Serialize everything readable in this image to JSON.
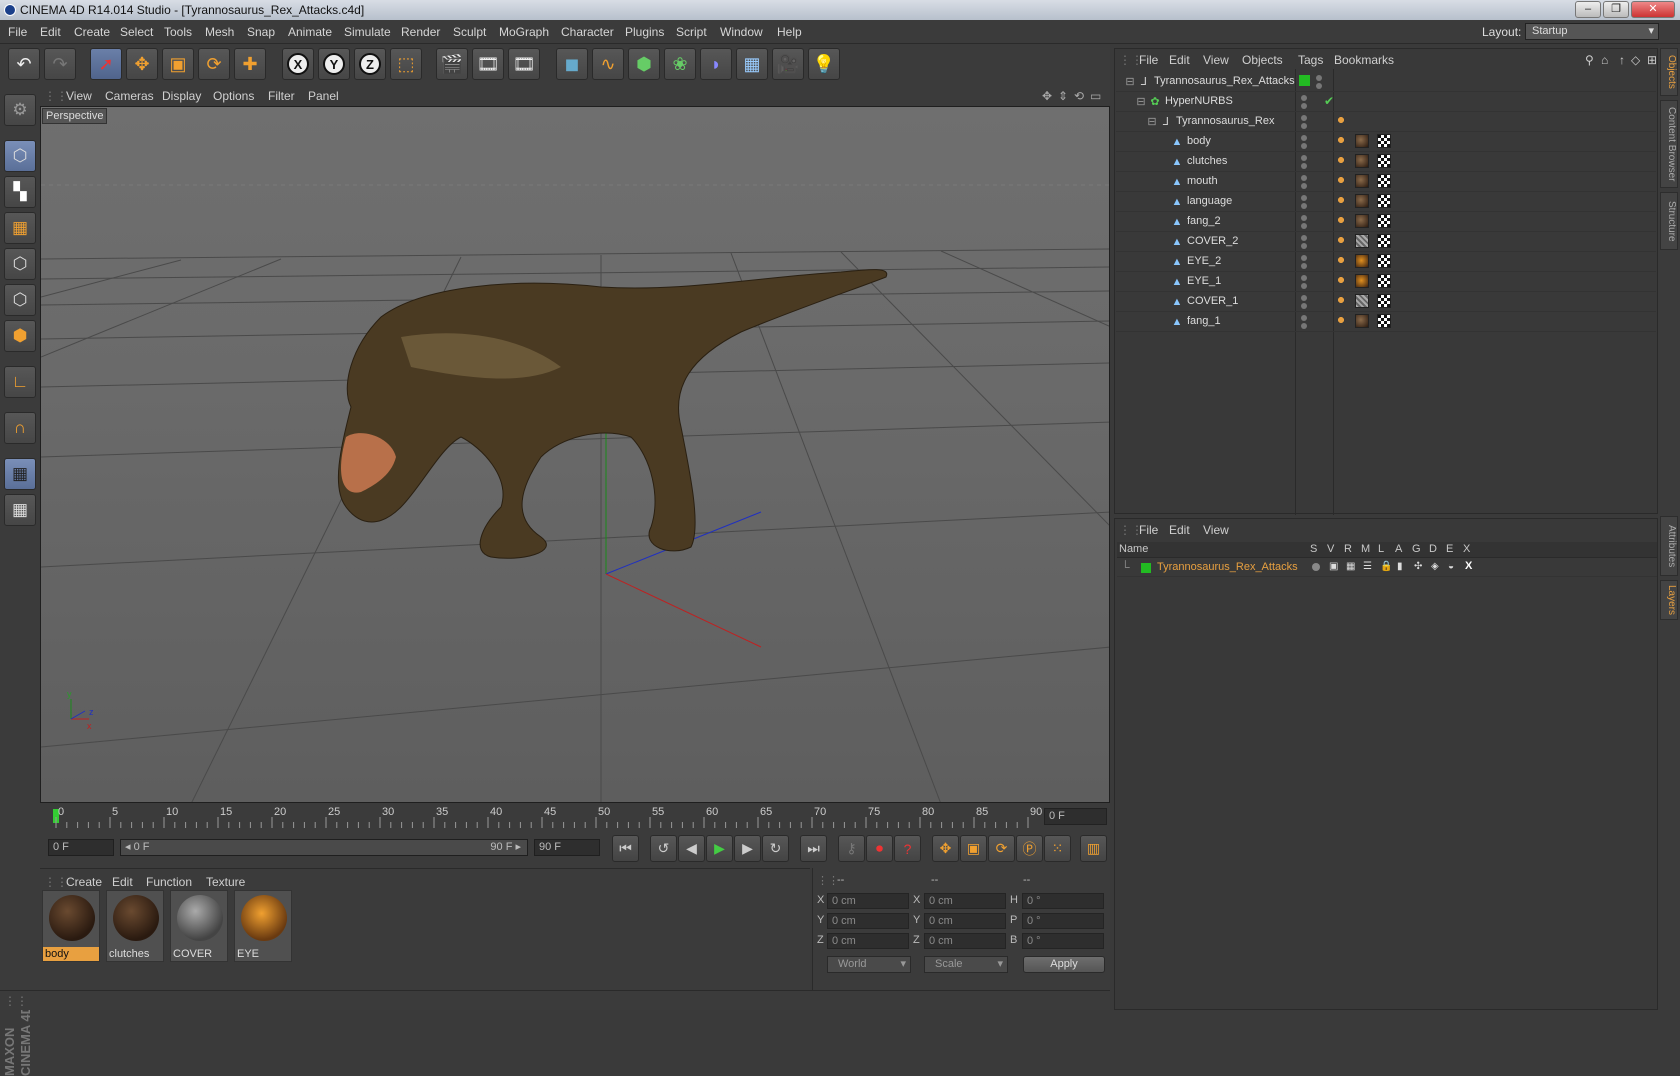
{
  "window": {
    "title": "CINEMA 4D R14.014 Studio - [Tyrannosaurus_Rex_Attacks.c4d]",
    "buttons": [
      "–",
      "❐",
      "✕"
    ]
  },
  "menubar": {
    "items": [
      "File",
      "Edit",
      "Create",
      "Select",
      "Tools",
      "Mesh",
      "Snap",
      "Animate",
      "Simulate",
      "Render",
      "Sculpt",
      "MoGraph",
      "Character",
      "Plugins",
      "Script",
      "Window",
      "Help"
    ],
    "layout_label": "Layout:",
    "layout_value": "Startup"
  },
  "toolbar": {
    "axis_x": "X",
    "axis_y": "Y",
    "axis_z": "Z"
  },
  "viewport": {
    "menu": [
      "View",
      "Cameras",
      "Display",
      "Options",
      "Filter",
      "Panel"
    ],
    "camera_label": "Perspective",
    "axis_labels": {
      "x": "x",
      "y": "y",
      "z": "z"
    }
  },
  "timeline": {
    "ticks": [
      "0",
      "5",
      "10",
      "15",
      "20",
      "25",
      "30",
      "35",
      "40",
      "45",
      "50",
      "55",
      "60",
      "65",
      "70",
      "75",
      "80",
      "85",
      "90"
    ],
    "current_frame": "0 F"
  },
  "transport": {
    "start": "0 F",
    "range_start": "◂ 0 F",
    "range_end": "90 F ▸",
    "end": "90 F"
  },
  "material_manager": {
    "menu": [
      "Create",
      "Edit",
      "Function",
      "Texture"
    ],
    "materials": [
      {
        "name": "body",
        "selected": true
      },
      {
        "name": "clutches",
        "selected": false
      },
      {
        "name": "COVER",
        "selected": false
      },
      {
        "name": "EYE",
        "selected": false
      }
    ]
  },
  "coordinates": {
    "headers": [
      "--",
      "--",
      "--"
    ],
    "rows": [
      {
        "a": "X",
        "av": "0 cm",
        "b": "X",
        "bv": "0 cm",
        "c": "H",
        "cv": "0 °"
      },
      {
        "a": "Y",
        "av": "0 cm",
        "b": "Y",
        "bv": "0 cm",
        "c": "P",
        "cv": "0 °"
      },
      {
        "a": "Z",
        "av": "0 cm",
        "b": "Z",
        "bv": "0 cm",
        "c": "B",
        "cv": "0 °"
      }
    ],
    "mode": "World",
    "transform": "Scale",
    "apply": "Apply"
  },
  "object_manager": {
    "menu": [
      "File",
      "Edit",
      "View",
      "Objects",
      "Tags",
      "Bookmarks"
    ],
    "objects": [
      {
        "name": "Tyrannosaurus_Rex_Attacks",
        "indent": 0,
        "tags": []
      },
      {
        "name": "HyperNURBS",
        "indent": 1,
        "tags": []
      },
      {
        "name": "Tyrannosaurus_Rex",
        "indent": 2,
        "tags": [
          "phong"
        ]
      },
      {
        "name": "body",
        "indent": 3,
        "tags": [
          "phong",
          "tex",
          "chk"
        ]
      },
      {
        "name": "clutches",
        "indent": 3,
        "tags": [
          "phong",
          "tex",
          "chk"
        ]
      },
      {
        "name": "mouth",
        "indent": 3,
        "tags": [
          "phong",
          "tex",
          "chk"
        ]
      },
      {
        "name": "language",
        "indent": 3,
        "tags": [
          "phong",
          "tex",
          "chk"
        ]
      },
      {
        "name": "fang_2",
        "indent": 3,
        "tags": [
          "phong",
          "tex",
          "chk"
        ]
      },
      {
        "name": "COVER_2",
        "indent": 3,
        "tags": [
          "phong",
          "cov",
          "chk"
        ]
      },
      {
        "name": "EYE_2",
        "indent": 3,
        "tags": [
          "phong",
          "eye",
          "chk"
        ]
      },
      {
        "name": "EYE_1",
        "indent": 3,
        "tags": [
          "phong",
          "eye",
          "chk"
        ]
      },
      {
        "name": "COVER_1",
        "indent": 3,
        "tags": [
          "phong",
          "cov",
          "chk"
        ]
      },
      {
        "name": "fang_1",
        "indent": 3,
        "tags": [
          "phong",
          "tex",
          "chk"
        ]
      }
    ]
  },
  "layer_manager": {
    "menu": [
      "File",
      "Edit",
      "View"
    ],
    "columns": [
      "Name",
      "S",
      "V",
      "R",
      "M",
      "L",
      "A",
      "G",
      "D",
      "E",
      "X"
    ],
    "layers": [
      {
        "name": "Tyrannosaurus_Rex_Attacks",
        "color": "#22bb22"
      }
    ]
  },
  "side_tabs": [
    "Objects",
    "Content Browser",
    "Structure",
    "Attributes",
    "Layers"
  ],
  "branding": "MAXON CINEMA 4D",
  "colors": {
    "accent": "#e8a040",
    "layer": "#22bb22",
    "x_axis": "#c02020",
    "y_axis": "#20a020",
    "z_axis": "#2030c0"
  }
}
